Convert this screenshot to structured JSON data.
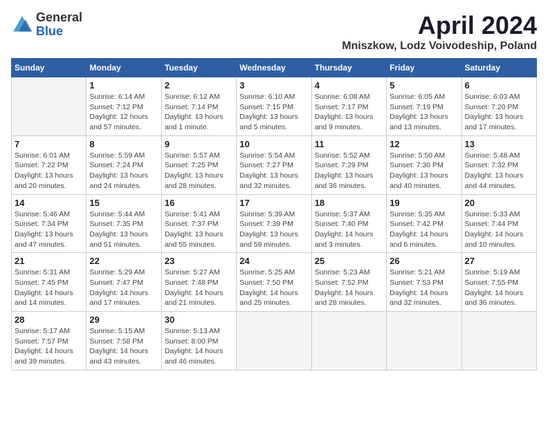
{
  "logo": {
    "general": "General",
    "blue": "Blue"
  },
  "title": "April 2024",
  "location": "Mniszkow, Lodz Voivodeship, Poland",
  "weekdays": [
    "Sunday",
    "Monday",
    "Tuesday",
    "Wednesday",
    "Thursday",
    "Friday",
    "Saturday"
  ],
  "weeks": [
    [
      {
        "day": "",
        "sunrise": "",
        "sunset": "",
        "daylight": ""
      },
      {
        "day": "1",
        "sunrise": "Sunrise: 6:14 AM",
        "sunset": "Sunset: 7:12 PM",
        "daylight": "Daylight: 12 hours and 57 minutes."
      },
      {
        "day": "2",
        "sunrise": "Sunrise: 6:12 AM",
        "sunset": "Sunset: 7:14 PM",
        "daylight": "Daylight: 13 hours and 1 minute."
      },
      {
        "day": "3",
        "sunrise": "Sunrise: 6:10 AM",
        "sunset": "Sunset: 7:15 PM",
        "daylight": "Daylight: 13 hours and 5 minutes."
      },
      {
        "day": "4",
        "sunrise": "Sunrise: 6:08 AM",
        "sunset": "Sunset: 7:17 PM",
        "daylight": "Daylight: 13 hours and 9 minutes."
      },
      {
        "day": "5",
        "sunrise": "Sunrise: 6:05 AM",
        "sunset": "Sunset: 7:19 PM",
        "daylight": "Daylight: 13 hours and 13 minutes."
      },
      {
        "day": "6",
        "sunrise": "Sunrise: 6:03 AM",
        "sunset": "Sunset: 7:20 PM",
        "daylight": "Daylight: 13 hours and 17 minutes."
      }
    ],
    [
      {
        "day": "7",
        "sunrise": "Sunrise: 6:01 AM",
        "sunset": "Sunset: 7:22 PM",
        "daylight": "Daylight: 13 hours and 20 minutes."
      },
      {
        "day": "8",
        "sunrise": "Sunrise: 5:59 AM",
        "sunset": "Sunset: 7:24 PM",
        "daylight": "Daylight: 13 hours and 24 minutes."
      },
      {
        "day": "9",
        "sunrise": "Sunrise: 5:57 AM",
        "sunset": "Sunset: 7:25 PM",
        "daylight": "Daylight: 13 hours and 28 minutes."
      },
      {
        "day": "10",
        "sunrise": "Sunrise: 5:54 AM",
        "sunset": "Sunset: 7:27 PM",
        "daylight": "Daylight: 13 hours and 32 minutes."
      },
      {
        "day": "11",
        "sunrise": "Sunrise: 5:52 AM",
        "sunset": "Sunset: 7:29 PM",
        "daylight": "Daylight: 13 hours and 36 minutes."
      },
      {
        "day": "12",
        "sunrise": "Sunrise: 5:50 AM",
        "sunset": "Sunset: 7:30 PM",
        "daylight": "Daylight: 13 hours and 40 minutes."
      },
      {
        "day": "13",
        "sunrise": "Sunrise: 5:48 AM",
        "sunset": "Sunset: 7:32 PM",
        "daylight": "Daylight: 13 hours and 44 minutes."
      }
    ],
    [
      {
        "day": "14",
        "sunrise": "Sunrise: 5:46 AM",
        "sunset": "Sunset: 7:34 PM",
        "daylight": "Daylight: 13 hours and 47 minutes."
      },
      {
        "day": "15",
        "sunrise": "Sunrise: 5:44 AM",
        "sunset": "Sunset: 7:35 PM",
        "daylight": "Daylight: 13 hours and 51 minutes."
      },
      {
        "day": "16",
        "sunrise": "Sunrise: 5:41 AM",
        "sunset": "Sunset: 7:37 PM",
        "daylight": "Daylight: 13 hours and 55 minutes."
      },
      {
        "day": "17",
        "sunrise": "Sunrise: 5:39 AM",
        "sunset": "Sunset: 7:39 PM",
        "daylight": "Daylight: 13 hours and 59 minutes."
      },
      {
        "day": "18",
        "sunrise": "Sunrise: 5:37 AM",
        "sunset": "Sunset: 7:40 PM",
        "daylight": "Daylight: 14 hours and 3 minutes."
      },
      {
        "day": "19",
        "sunrise": "Sunrise: 5:35 AM",
        "sunset": "Sunset: 7:42 PM",
        "daylight": "Daylight: 14 hours and 6 minutes."
      },
      {
        "day": "20",
        "sunrise": "Sunrise: 5:33 AM",
        "sunset": "Sunset: 7:44 PM",
        "daylight": "Daylight: 14 hours and 10 minutes."
      }
    ],
    [
      {
        "day": "21",
        "sunrise": "Sunrise: 5:31 AM",
        "sunset": "Sunset: 7:45 PM",
        "daylight": "Daylight: 14 hours and 14 minutes."
      },
      {
        "day": "22",
        "sunrise": "Sunrise: 5:29 AM",
        "sunset": "Sunset: 7:47 PM",
        "daylight": "Daylight: 14 hours and 17 minutes."
      },
      {
        "day": "23",
        "sunrise": "Sunrise: 5:27 AM",
        "sunset": "Sunset: 7:48 PM",
        "daylight": "Daylight: 14 hours and 21 minutes."
      },
      {
        "day": "24",
        "sunrise": "Sunrise: 5:25 AM",
        "sunset": "Sunset: 7:50 PM",
        "daylight": "Daylight: 14 hours and 25 minutes."
      },
      {
        "day": "25",
        "sunrise": "Sunrise: 5:23 AM",
        "sunset": "Sunset: 7:52 PM",
        "daylight": "Daylight: 14 hours and 28 minutes."
      },
      {
        "day": "26",
        "sunrise": "Sunrise: 5:21 AM",
        "sunset": "Sunset: 7:53 PM",
        "daylight": "Daylight: 14 hours and 32 minutes."
      },
      {
        "day": "27",
        "sunrise": "Sunrise: 5:19 AM",
        "sunset": "Sunset: 7:55 PM",
        "daylight": "Daylight: 14 hours and 36 minutes."
      }
    ],
    [
      {
        "day": "28",
        "sunrise": "Sunrise: 5:17 AM",
        "sunset": "Sunset: 7:57 PM",
        "daylight": "Daylight: 14 hours and 39 minutes."
      },
      {
        "day": "29",
        "sunrise": "Sunrise: 5:15 AM",
        "sunset": "Sunset: 7:58 PM",
        "daylight": "Daylight: 14 hours and 43 minutes."
      },
      {
        "day": "30",
        "sunrise": "Sunrise: 5:13 AM",
        "sunset": "Sunset: 8:00 PM",
        "daylight": "Daylight: 14 hours and 46 minutes."
      },
      {
        "day": "",
        "sunrise": "",
        "sunset": "",
        "daylight": ""
      },
      {
        "day": "",
        "sunrise": "",
        "sunset": "",
        "daylight": ""
      },
      {
        "day": "",
        "sunrise": "",
        "sunset": "",
        "daylight": ""
      },
      {
        "day": "",
        "sunrise": "",
        "sunset": "",
        "daylight": ""
      }
    ]
  ]
}
